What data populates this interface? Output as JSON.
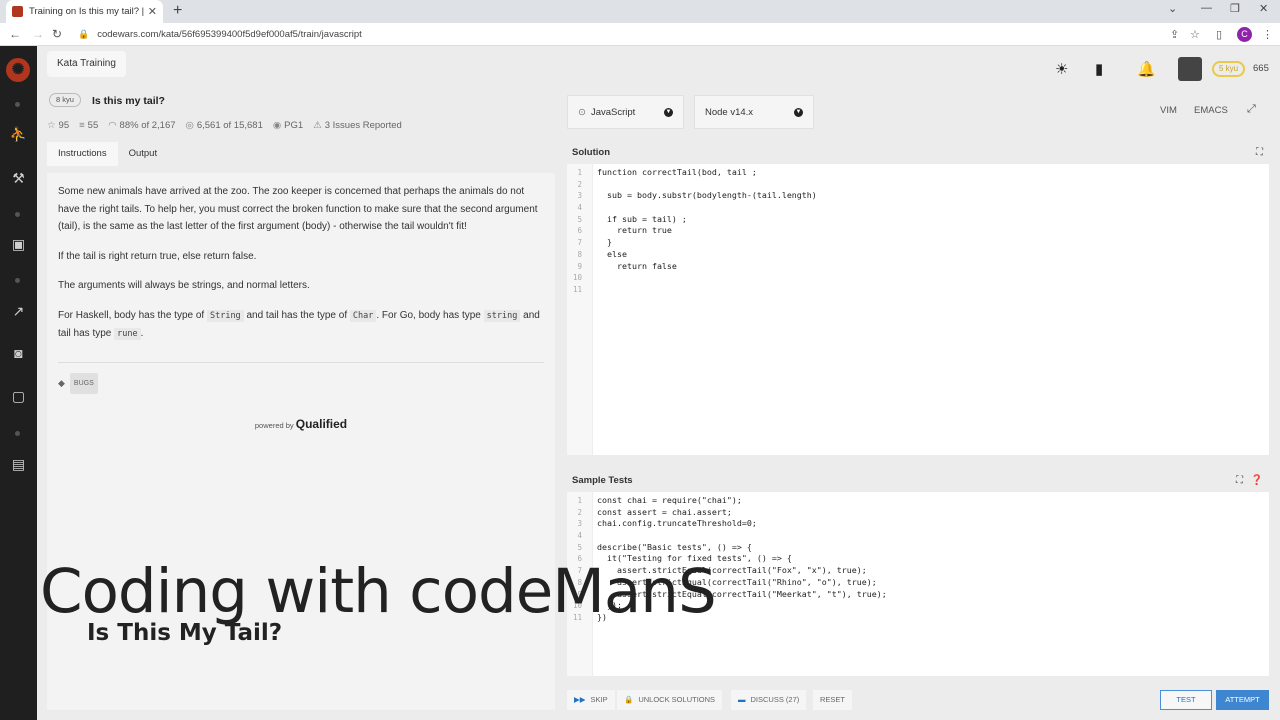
{
  "browser": {
    "tab_title": "Training on Is this my tail? | Codewars",
    "url": "codewars.com/kata/56f695399400f5d9ef000af5/train/javascript",
    "profile_initial": "C"
  },
  "header": {
    "breadcrumb": "Kata Training",
    "rank_badge": "5 kyu",
    "honor": "665"
  },
  "kata": {
    "kyu": "8 kyu",
    "title": "Is this my tail?",
    "stars": "95",
    "collections": "55",
    "satisfaction": "88%",
    "satisfaction_of": "of 2,167",
    "completed": "6,561 of 15,681",
    "author": "PG1",
    "issues": "3 Issues Reported"
  },
  "tabs": {
    "instructions": "Instructions",
    "output": "Output"
  },
  "description": {
    "p1": "Some new animals have arrived at the zoo. The zoo keeper is concerned that perhaps the animals do not have the right tails. To help her, you must correct the broken function to make sure that the second argument (tail), is the same as the last letter of the first argument (body) - otherwise the tail wouldn't fit!",
    "p2": "If the tail is right return true, else return false.",
    "p3": "The arguments will always be strings, and normal letters.",
    "p4_a": "For Haskell, body has the type of",
    "p4_code1": "String",
    "p4_b": "and tail has the type of",
    "p4_code2": "Char",
    "p4_c": ". For Go, body has type",
    "p4_code3": "string",
    "p4_d": "and tail has type",
    "p4_code4": "rune",
    "p4_e": ".",
    "tag": "BUGS",
    "powered_by": "powered by",
    "powered_brand": "Qualified"
  },
  "selectors": {
    "language": "JavaScript",
    "version": "Node v14.x",
    "vim": "VIM",
    "emacs": "EMACS"
  },
  "solution": {
    "title": "Solution",
    "lines": [
      "function correctTail(bod, tail ;",
      "",
      "  sub = body.substr(bodylength-(tail.length)",
      "",
      "  if sub = tail) ;",
      "    return true",
      "  }",
      "  else",
      "    return false",
      "",
      ""
    ]
  },
  "tests": {
    "title": "Sample Tests",
    "lines": [
      "const chai = require(\"chai\");",
      "const assert = chai.assert;",
      "chai.config.truncateThreshold=0;",
      "",
      "describe(\"Basic tests\", () => {",
      "  it(\"Testing for fixed tests\", () => {",
      "    assert.strictEqual(correctTail(\"Fox\", \"x\"), true);",
      "    assert.strictEqual(correctTail(\"Rhino\", \"o\"), true);",
      "    assert.strictEqual(correctTail(\"Meerkat\", \"t\"), true);",
      "  });",
      "})"
    ]
  },
  "actions": {
    "skip": "SKIP",
    "unlock": "UNLOCK SOLUTIONS",
    "discuss": "DISCUSS (27)",
    "reset": "RESET",
    "test": "TEST",
    "attempt": "ATTEMPT"
  },
  "overlay": {
    "main": "Coding with codeManS",
    "sub": "Is This My Tail?"
  }
}
